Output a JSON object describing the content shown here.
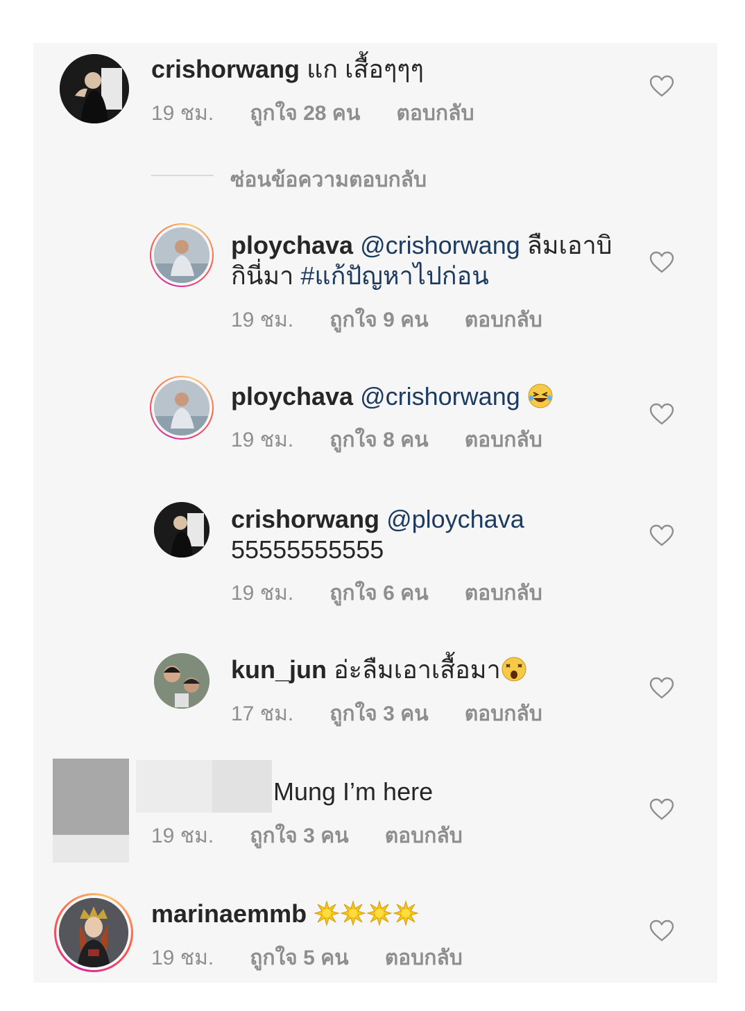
{
  "comments": [
    {
      "username": "crishorwang",
      "text": " แก เสื้อๆๆๆ",
      "time": "19 ชม.",
      "likes": "ถูกใจ 28 คน",
      "reply": "ตอบกลับ"
    },
    {
      "username": "ploychava",
      "mention": "@crishorwang",
      "text": " ลืมเอาบิ",
      "text2": "กินี่มา ",
      "hashtag": "#แก้ปัญหาไปก่อน",
      "time": "19 ชม.",
      "likes": "ถูกใจ 9 คน",
      "reply": "ตอบกลับ"
    },
    {
      "username": "ploychava",
      "mention": "@crishorwang",
      "emoji": "laughing-emoji",
      "time": "19 ชม.",
      "likes": "ถูกใจ 8 คน",
      "reply": "ตอบกลับ"
    },
    {
      "username": "crishorwang",
      "mention": "@ploychava",
      "text2": "55555555555",
      "time": "19 ชม.",
      "likes": "ถูกใจ 6 คน",
      "reply": "ตอบกลับ"
    },
    {
      "username": "kun_jun",
      "text": " อ่ะลืมเอาเสื้อมา",
      "emoji": "astonished-emoji",
      "time": "17 ชม.",
      "likes": "ถูกใจ 3 คน",
      "reply": "ตอบกลับ"
    },
    {
      "text": "Mung I’m here",
      "time": "19 ชม.",
      "likes": "ถูกใจ 3 คน",
      "reply": "ตอบกลับ"
    },
    {
      "username": "marinaemmb",
      "emoji": "sun-emoji",
      "time": "19 ชม.",
      "likes": "ถูกใจ 5 คน",
      "reply": "ตอบกลับ"
    }
  ],
  "hide_replies": "ซ่อนข้อความตอบกลับ",
  "colors": {
    "mention": "#1d3a5f",
    "meta": "#8e8e8e",
    "ring": "#d6249f"
  }
}
